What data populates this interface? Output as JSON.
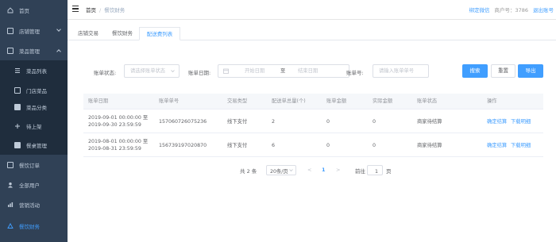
{
  "sidebar": {
    "items": [
      {
        "label": "首页",
        "icon": "home-icon"
      },
      {
        "label": "店铺管理",
        "icon": "store-icon"
      },
      {
        "label": "菜品管理",
        "icon": "dish-icon"
      },
      {
        "label": "菜品列表",
        "icon": "list-icon"
      },
      {
        "label": "门店菜品",
        "icon": "shop-dish-icon"
      },
      {
        "label": "菜品分类",
        "icon": "category-icon"
      },
      {
        "label": "待上架",
        "icon": "pending-icon"
      },
      {
        "label": "餐桌管理",
        "icon": "table-icon"
      },
      {
        "label": "餐饮订单",
        "icon": "order-icon"
      },
      {
        "label": "全部用户",
        "icon": "users-icon"
      },
      {
        "label": "营销活动",
        "icon": "marketing-icon"
      },
      {
        "label": "餐饮财务",
        "icon": "finance-icon"
      }
    ]
  },
  "header": {
    "breadcrumb_1": "首页",
    "breadcrumb_sep": "/",
    "breadcrumb_2": "餐饮财务",
    "bind_wechat": "绑定微信",
    "account_label": "商户号：",
    "account_no": "3786",
    "logout": "退出账号"
  },
  "tabs": [
    "店铺交易",
    "餐饮财务",
    "配送费列表"
  ],
  "filters": {
    "status_label": "账单状态:",
    "status_placeholder": "请选择账单状态",
    "date_label": "账单日期:",
    "start_placeholder": "开始日期",
    "date_sep": "至",
    "end_placeholder": "结束日期",
    "bill_no_label": "账单号:",
    "bill_no_placeholder": "请输入账单单号",
    "search": "搜索",
    "reset": "重置",
    "export": "导出"
  },
  "table": {
    "headers": [
      "账单日期",
      "账单单号",
      "交易类型",
      "配送单总量(个)",
      "账单金额",
      "实际金额",
      "账单状态",
      "操作"
    ],
    "rows": [
      {
        "date_line1": "2019-09-01 00:00:00 至",
        "date_line2": "2019-09-30 23:59:59",
        "bill_no": "157060726075236",
        "type": "线下支付",
        "count": "2",
        "amount": "0",
        "actual": "0",
        "status": "商家待结算",
        "action_confirm": "确定结算",
        "action_download": "下载明细"
      },
      {
        "date_line1": "2019-08-01 00:00:00 至",
        "date_line2": "2019-08-31 23:59:59",
        "bill_no": "156739197020870",
        "type": "线下支付",
        "count": "6",
        "amount": "0",
        "actual": "0",
        "status": "商家待结算",
        "action_confirm": "确定结算",
        "action_download": "下载明细"
      }
    ]
  },
  "pagination": {
    "total": "共 2 条",
    "page_size": "20条/页",
    "prev": "<",
    "current_page": "1",
    "next": ">",
    "goto_label": "前往",
    "goto_value": "1",
    "page_unit": "页"
  },
  "colors": {
    "sidebar_bg": "#304156",
    "sidebar_sub_bg": "#1f2d3d",
    "primary": "#409eff"
  }
}
